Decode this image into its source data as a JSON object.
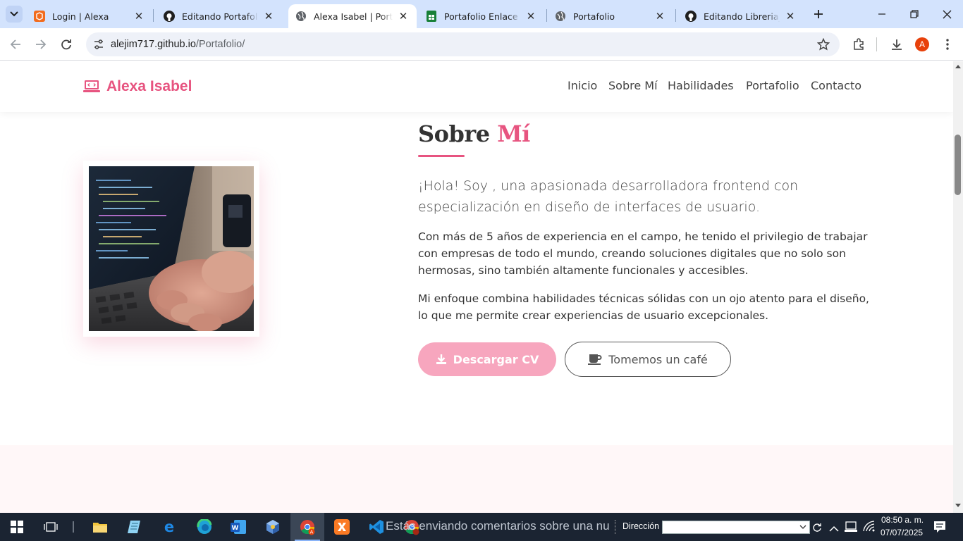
{
  "browser": {
    "tabs": [
      {
        "title": "Login | Alexa",
        "icon": "codepen-orange-icon"
      },
      {
        "title": "Editando Portafolio/R",
        "icon": "github-icon"
      },
      {
        "title": "Alexa Isabel | Portafol",
        "icon": "globe-icon",
        "active": true
      },
      {
        "title": "Portafolio Enlace de",
        "icon": "google-sheets-icon"
      },
      {
        "title": "Portafolio",
        "icon": "globe-icon"
      },
      {
        "title": "Editando Libreria_Esp",
        "icon": "github-icon"
      }
    ],
    "url_host": "alejim717.github.io",
    "url_path": "/Portafolio/",
    "profile_initial": "A"
  },
  "site": {
    "brand": "Alexa Isabel",
    "nav": [
      "Inicio",
      "Sobre Mí",
      "Habilidades",
      "Portafolio",
      "Contacto"
    ],
    "about": {
      "title_main": "Sobre",
      "title_accent": "Mí",
      "lead": "¡Hola! Soy , una apasionada desarrolladora frontend con especialización en diseño de interfaces de usuario.",
      "paragraphs": [
        "Con más de 5 años de experiencia en el campo, he tenido el privilegio de trabajar con empresas de todo el mundo, creando soluciones digitales que no solo son hermosas, sino también altamente funcionales y accesibles.",
        "Mi enfoque combina habilidades técnicas sólidas con un ojo atento para el diseño, lo que me permite crear experiencias de usuario excepcionales."
      ],
      "btn_cv": "Descargar CV",
      "btn_coffee": "Tomemos un café"
    },
    "colors": {
      "accent": "#e75480",
      "button_cv": "#f7a6be"
    }
  },
  "taskbar": {
    "behind_text": "Estás enviando comentarios sobre una nu",
    "address_label": "Dirección",
    "time": "08:50 a. m.",
    "date": "07/07/2025"
  }
}
